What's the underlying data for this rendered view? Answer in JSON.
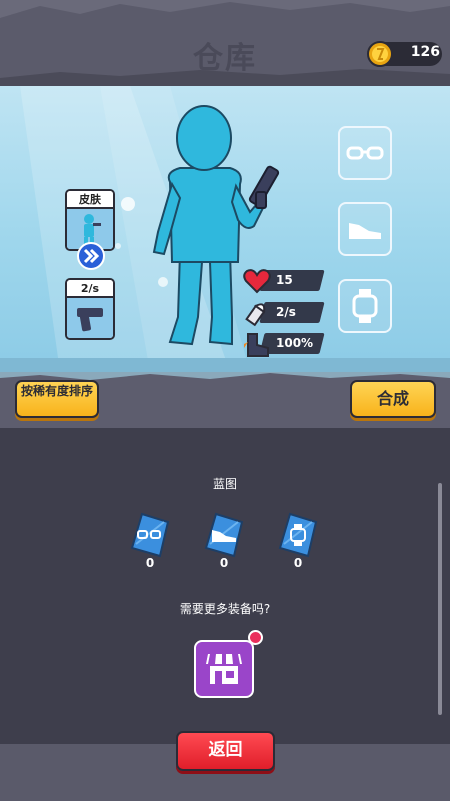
{
  "header": {
    "title": "仓库",
    "coins": "126"
  },
  "left_cards": [
    {
      "label": "皮肤"
    },
    {
      "label": "2/s"
    }
  ],
  "equip_slots": [
    {
      "icon": "glasses-icon"
    },
    {
      "icon": "shoe-icon"
    },
    {
      "icon": "watch-icon"
    }
  ],
  "stats": [
    {
      "icon": "heart-icon",
      "value": "15"
    },
    {
      "icon": "bullet-icon",
      "value": "2/s"
    },
    {
      "icon": "boot-icon",
      "value": "100%"
    }
  ],
  "toolbar": {
    "sort_label": "按稀有度排序",
    "craft_label": "合成"
  },
  "blueprints": {
    "title": "蓝图",
    "items": [
      {
        "icon": "glasses-blueprint-icon",
        "count": "0"
      },
      {
        "icon": "shoe-blueprint-icon",
        "count": "0"
      },
      {
        "icon": "watch-blueprint-icon",
        "count": "0"
      }
    ]
  },
  "more_equipment": "需要更多装备吗?",
  "footer": {
    "back_label": "返回"
  },
  "colors": {
    "accent_yellow": "#f8b31b",
    "back_red": "#e01e2a",
    "shop_purple": "#9a45c9",
    "blueprint_blue": "#3b8fde",
    "character_cyan": "#2fb8dd"
  }
}
